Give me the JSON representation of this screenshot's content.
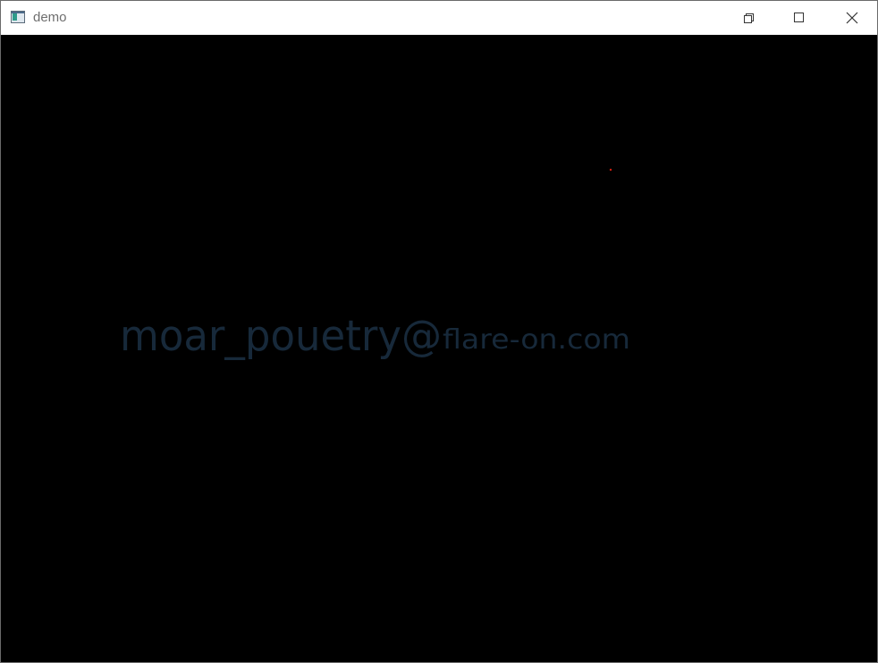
{
  "window": {
    "title": "demo",
    "icons": {
      "app": "app-window-icon",
      "restore": "restore-icon",
      "maximize": "maximize-icon",
      "close": "close-icon"
    }
  },
  "canvas": {
    "text_part1": "moar_pouetry@",
    "text_part2": "flare-on.com",
    "text_color": "#17293a",
    "background_color": "#000000",
    "dot_color": "#d02010"
  }
}
